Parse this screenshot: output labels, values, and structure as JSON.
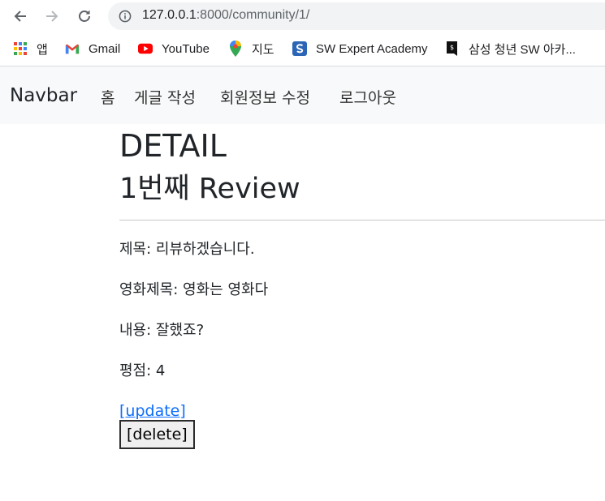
{
  "browser": {
    "url_host": "127.0.0.1",
    "url_rest": ":8000/community/1/",
    "bookmarks": [
      {
        "label": "앱",
        "icon": "apps-grid-icon"
      },
      {
        "label": "Gmail",
        "icon": "gmail-icon"
      },
      {
        "label": "YouTube",
        "icon": "youtube-icon"
      },
      {
        "label": "지도",
        "icon": "maps-pin-icon"
      },
      {
        "label": "SW Expert Academy",
        "icon": "swea-icon"
      },
      {
        "label": "삼성 청년 SW 아카...",
        "icon": "ssafy-icon"
      }
    ]
  },
  "navbar": {
    "brand": "Navbar",
    "links": [
      "홈",
      "게글 작성",
      "회원정보 수정",
      "로그아웃"
    ]
  },
  "detail": {
    "heading": "DETAIL",
    "subheading": "1번째 Review",
    "fields": [
      {
        "label": "제목:",
        "value": "리뷰하겠습니다."
      },
      {
        "label": "영화제목:",
        "value": "영화는 영화다"
      },
      {
        "label": "내용:",
        "value": "잘했죠?"
      },
      {
        "label": "평점:",
        "value": "4"
      }
    ],
    "update_label": "[update]",
    "delete_label": "[delete]"
  },
  "colors": {
    "navbar_bg": "#f8f9fa",
    "link": "#0d6efd",
    "youtube_red": "#ff0000"
  }
}
